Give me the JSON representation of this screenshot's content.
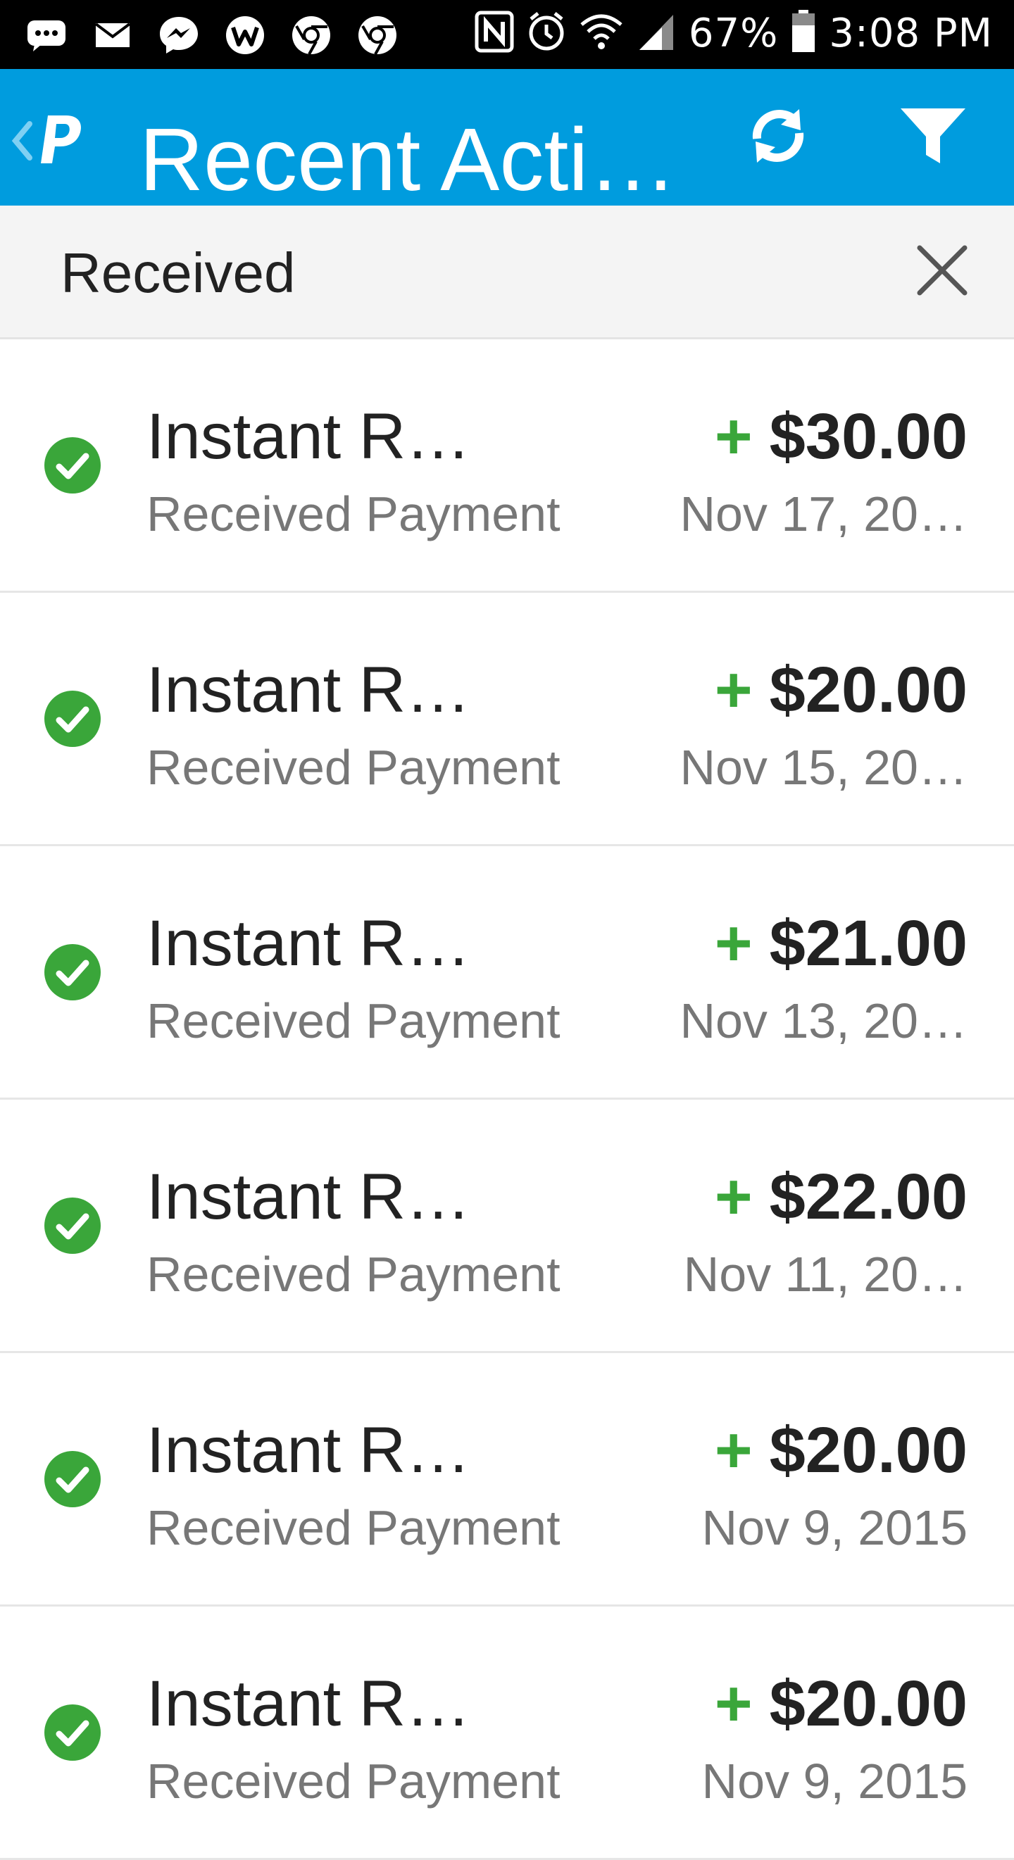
{
  "status_bar": {
    "battery": "67%",
    "time": "3:08 PM",
    "left_icons": [
      "chat-icon",
      "mail-icon",
      "messenger-icon",
      "w-app-icon",
      "chrome-icon",
      "chrome-icon"
    ],
    "right_icons": [
      "nfc-icon",
      "alarm-icon",
      "wifi-icon",
      "signal-icon",
      "battery-icon"
    ]
  },
  "app_bar": {
    "title": "Recent Acti…",
    "color": "#009cde",
    "back_icon": "chevron-left-icon",
    "logo_icon": "paypal-logo-icon",
    "refresh_icon": "refresh-icon",
    "filter_icon": "filter-icon"
  },
  "filter": {
    "label": "Received",
    "close_icon": "close-icon"
  },
  "transactions": [
    {
      "name": "Instant R…",
      "type": "Received Payment",
      "sign": "+",
      "amount": "$30.00",
      "date": "Nov 17, 20…",
      "status_icon": "check-circle-icon"
    },
    {
      "name": "Instant R…",
      "type": "Received Payment",
      "sign": "+",
      "amount": "$20.00",
      "date": "Nov 15, 20…",
      "status_icon": "check-circle-icon"
    },
    {
      "name": "Instant R…",
      "type": "Received Payment",
      "sign": "+",
      "amount": "$21.00",
      "date": "Nov 13, 20…",
      "status_icon": "check-circle-icon"
    },
    {
      "name": "Instant R…",
      "type": "Received Payment",
      "sign": "+",
      "amount": "$22.00",
      "date": "Nov 11, 20…",
      "status_icon": "check-circle-icon"
    },
    {
      "name": "Instant R…",
      "type": "Received Payment",
      "sign": "+",
      "amount": "$20.00",
      "date": "Nov 9, 2015",
      "status_icon": "check-circle-icon"
    },
    {
      "name": "Instant R…",
      "type": "Received Payment",
      "sign": "+",
      "amount": "$20.00",
      "date": "Nov 9, 2015",
      "status_icon": "check-circle-icon"
    }
  ],
  "colors": {
    "accent": "#009cde",
    "success": "#3aa63a",
    "text_primary": "#222222",
    "text_secondary": "#777777"
  }
}
